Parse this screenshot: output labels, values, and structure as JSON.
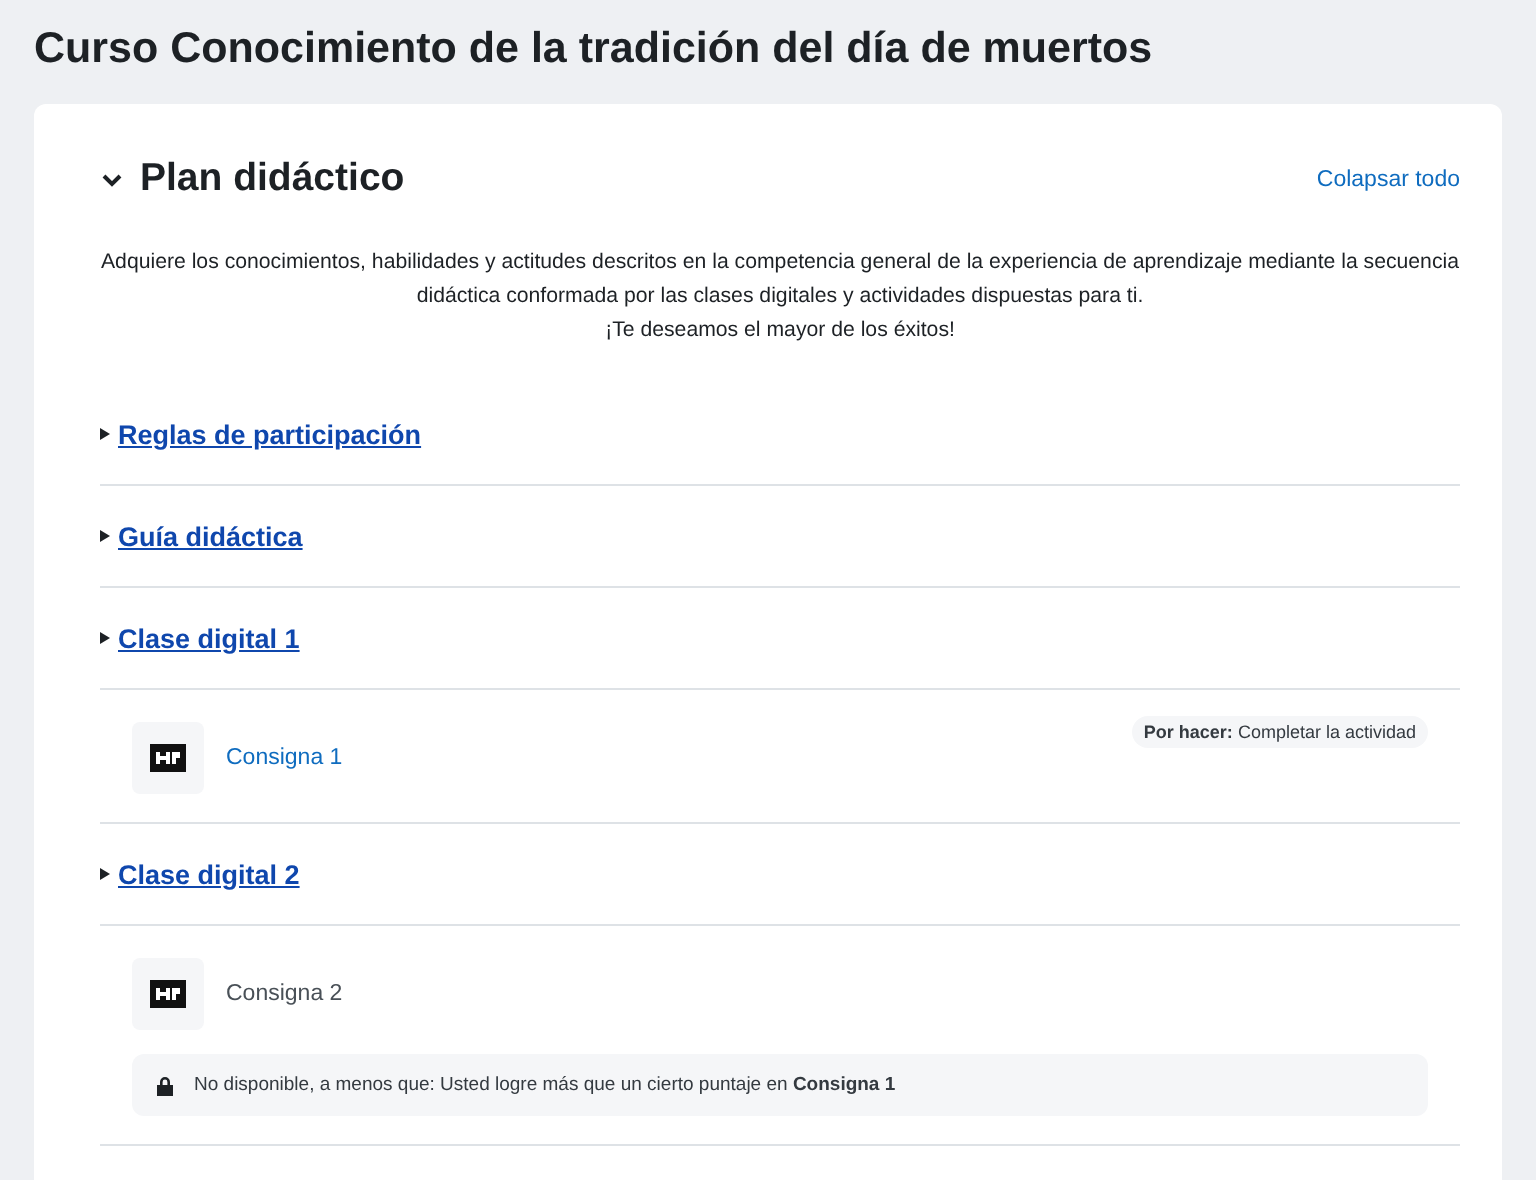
{
  "page_title": "Curso Conocimiento de la tradición del día de muertos",
  "section": {
    "title": "Plan didáctico",
    "expanded": true,
    "collapse_link": "Colapsar todo",
    "summary": [
      "Adquiere los conocimientos, habilidades y actitudes descritos en la competencia general de la experiencia de aprendizaje mediante la secuencia didáctica conformada por las clases digitales y actividades dispuestas para ti.",
      "¡Te deseamos el mayor de los éxitos!"
    ]
  },
  "subsections": [
    {
      "title": "Reglas de participación"
    },
    {
      "title": "Guía didáctica"
    },
    {
      "title": "Clase digital 1",
      "activities": [
        {
          "name": "Consigna 1",
          "available": true,
          "completion": {
            "label": "Por hacer:",
            "text": "Completar la actividad"
          }
        }
      ]
    },
    {
      "title": "Clase digital 2",
      "activities": [
        {
          "name": "Consigna 2",
          "available": false,
          "restriction": "No disponible, a menos que: Usted logre más que un cierto puntaje en **Consigna 1**"
        }
      ]
    }
  ]
}
